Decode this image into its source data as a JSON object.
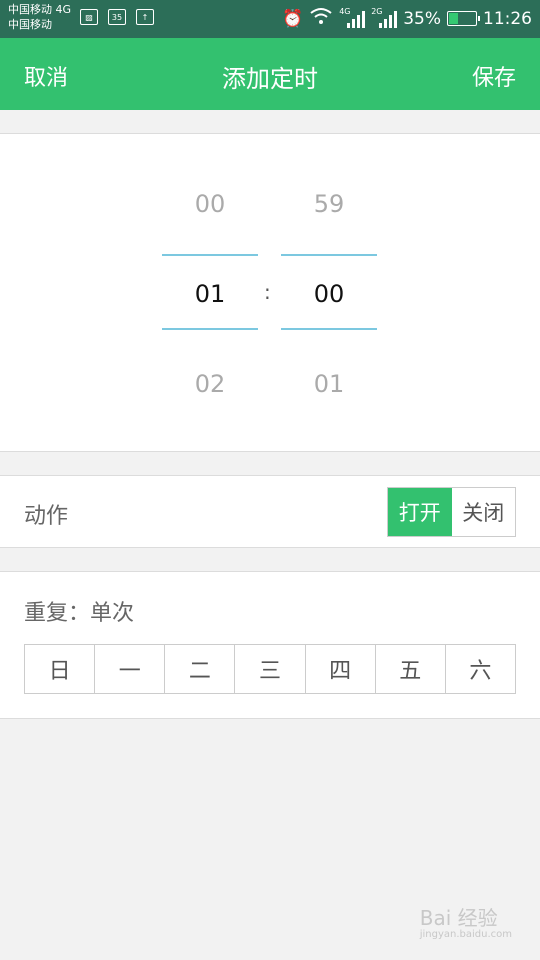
{
  "status_bar": {
    "carrier_1": "中国移动 4G",
    "carrier_2": "中国移动",
    "notif_badge": "35",
    "net_1": "4G",
    "net_2": "2G",
    "battery_percent": "35%",
    "battery_level": 0.35,
    "time": "11:26"
  },
  "appbar": {
    "cancel_label": "取消",
    "title": "添加定时",
    "save_label": "保存"
  },
  "picker": {
    "hours": {
      "prev": "00",
      "selected": "01",
      "next": "02"
    },
    "separator": ":",
    "minutes": {
      "prev": "59",
      "selected": "00",
      "next": "01"
    }
  },
  "action": {
    "label": "动作",
    "on_label": "打开",
    "off_label": "关闭",
    "selected": "on"
  },
  "repeat": {
    "label": "重复：单次",
    "days": [
      "日",
      "一",
      "二",
      "三",
      "四",
      "五",
      "六"
    ]
  },
  "watermark": {
    "brand": "Bai 经验",
    "url": "jingyan.baidu.com"
  },
  "colors": {
    "accent": "#33c16f",
    "status_bar": "#2c6e58",
    "picker_line": "#7cc8e0"
  }
}
